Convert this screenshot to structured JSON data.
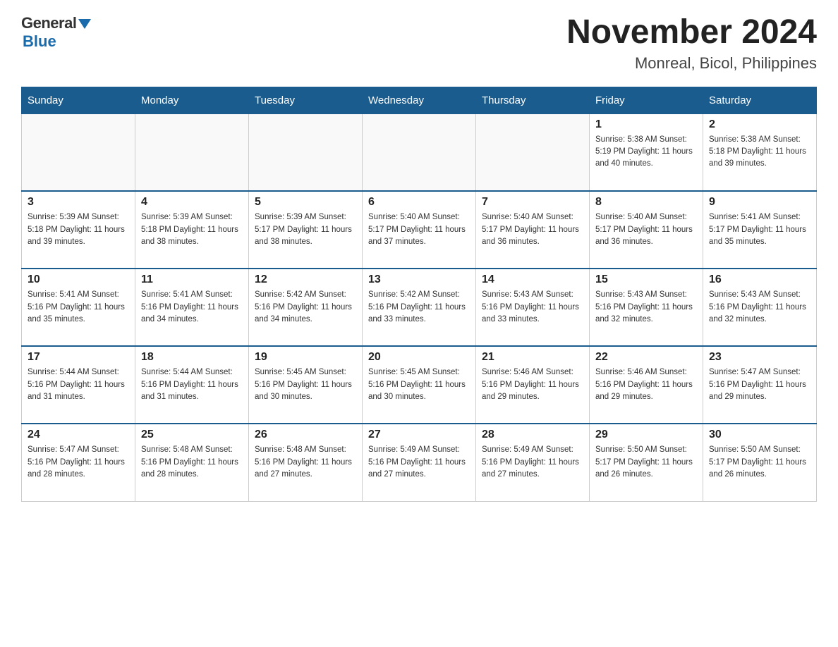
{
  "header": {
    "logo_general": "General",
    "logo_blue": "Blue",
    "month_title": "November 2024",
    "location": "Monreal, Bicol, Philippines"
  },
  "calendar": {
    "days_of_week": [
      "Sunday",
      "Monday",
      "Tuesday",
      "Wednesday",
      "Thursday",
      "Friday",
      "Saturday"
    ],
    "weeks": [
      [
        {
          "day": "",
          "info": ""
        },
        {
          "day": "",
          "info": ""
        },
        {
          "day": "",
          "info": ""
        },
        {
          "day": "",
          "info": ""
        },
        {
          "day": "",
          "info": ""
        },
        {
          "day": "1",
          "info": "Sunrise: 5:38 AM\nSunset: 5:19 PM\nDaylight: 11 hours\nand 40 minutes."
        },
        {
          "day": "2",
          "info": "Sunrise: 5:38 AM\nSunset: 5:18 PM\nDaylight: 11 hours\nand 39 minutes."
        }
      ],
      [
        {
          "day": "3",
          "info": "Sunrise: 5:39 AM\nSunset: 5:18 PM\nDaylight: 11 hours\nand 39 minutes."
        },
        {
          "day": "4",
          "info": "Sunrise: 5:39 AM\nSunset: 5:18 PM\nDaylight: 11 hours\nand 38 minutes."
        },
        {
          "day": "5",
          "info": "Sunrise: 5:39 AM\nSunset: 5:17 PM\nDaylight: 11 hours\nand 38 minutes."
        },
        {
          "day": "6",
          "info": "Sunrise: 5:40 AM\nSunset: 5:17 PM\nDaylight: 11 hours\nand 37 minutes."
        },
        {
          "day": "7",
          "info": "Sunrise: 5:40 AM\nSunset: 5:17 PM\nDaylight: 11 hours\nand 36 minutes."
        },
        {
          "day": "8",
          "info": "Sunrise: 5:40 AM\nSunset: 5:17 PM\nDaylight: 11 hours\nand 36 minutes."
        },
        {
          "day": "9",
          "info": "Sunrise: 5:41 AM\nSunset: 5:17 PM\nDaylight: 11 hours\nand 35 minutes."
        }
      ],
      [
        {
          "day": "10",
          "info": "Sunrise: 5:41 AM\nSunset: 5:16 PM\nDaylight: 11 hours\nand 35 minutes."
        },
        {
          "day": "11",
          "info": "Sunrise: 5:41 AM\nSunset: 5:16 PM\nDaylight: 11 hours\nand 34 minutes."
        },
        {
          "day": "12",
          "info": "Sunrise: 5:42 AM\nSunset: 5:16 PM\nDaylight: 11 hours\nand 34 minutes."
        },
        {
          "day": "13",
          "info": "Sunrise: 5:42 AM\nSunset: 5:16 PM\nDaylight: 11 hours\nand 33 minutes."
        },
        {
          "day": "14",
          "info": "Sunrise: 5:43 AM\nSunset: 5:16 PM\nDaylight: 11 hours\nand 33 minutes."
        },
        {
          "day": "15",
          "info": "Sunrise: 5:43 AM\nSunset: 5:16 PM\nDaylight: 11 hours\nand 32 minutes."
        },
        {
          "day": "16",
          "info": "Sunrise: 5:43 AM\nSunset: 5:16 PM\nDaylight: 11 hours\nand 32 minutes."
        }
      ],
      [
        {
          "day": "17",
          "info": "Sunrise: 5:44 AM\nSunset: 5:16 PM\nDaylight: 11 hours\nand 31 minutes."
        },
        {
          "day": "18",
          "info": "Sunrise: 5:44 AM\nSunset: 5:16 PM\nDaylight: 11 hours\nand 31 minutes."
        },
        {
          "day": "19",
          "info": "Sunrise: 5:45 AM\nSunset: 5:16 PM\nDaylight: 11 hours\nand 30 minutes."
        },
        {
          "day": "20",
          "info": "Sunrise: 5:45 AM\nSunset: 5:16 PM\nDaylight: 11 hours\nand 30 minutes."
        },
        {
          "day": "21",
          "info": "Sunrise: 5:46 AM\nSunset: 5:16 PM\nDaylight: 11 hours\nand 29 minutes."
        },
        {
          "day": "22",
          "info": "Sunrise: 5:46 AM\nSunset: 5:16 PM\nDaylight: 11 hours\nand 29 minutes."
        },
        {
          "day": "23",
          "info": "Sunrise: 5:47 AM\nSunset: 5:16 PM\nDaylight: 11 hours\nand 29 minutes."
        }
      ],
      [
        {
          "day": "24",
          "info": "Sunrise: 5:47 AM\nSunset: 5:16 PM\nDaylight: 11 hours\nand 28 minutes."
        },
        {
          "day": "25",
          "info": "Sunrise: 5:48 AM\nSunset: 5:16 PM\nDaylight: 11 hours\nand 28 minutes."
        },
        {
          "day": "26",
          "info": "Sunrise: 5:48 AM\nSunset: 5:16 PM\nDaylight: 11 hours\nand 27 minutes."
        },
        {
          "day": "27",
          "info": "Sunrise: 5:49 AM\nSunset: 5:16 PM\nDaylight: 11 hours\nand 27 minutes."
        },
        {
          "day": "28",
          "info": "Sunrise: 5:49 AM\nSunset: 5:16 PM\nDaylight: 11 hours\nand 27 minutes."
        },
        {
          "day": "29",
          "info": "Sunrise: 5:50 AM\nSunset: 5:17 PM\nDaylight: 11 hours\nand 26 minutes."
        },
        {
          "day": "30",
          "info": "Sunrise: 5:50 AM\nSunset: 5:17 PM\nDaylight: 11 hours\nand 26 minutes."
        }
      ]
    ]
  }
}
